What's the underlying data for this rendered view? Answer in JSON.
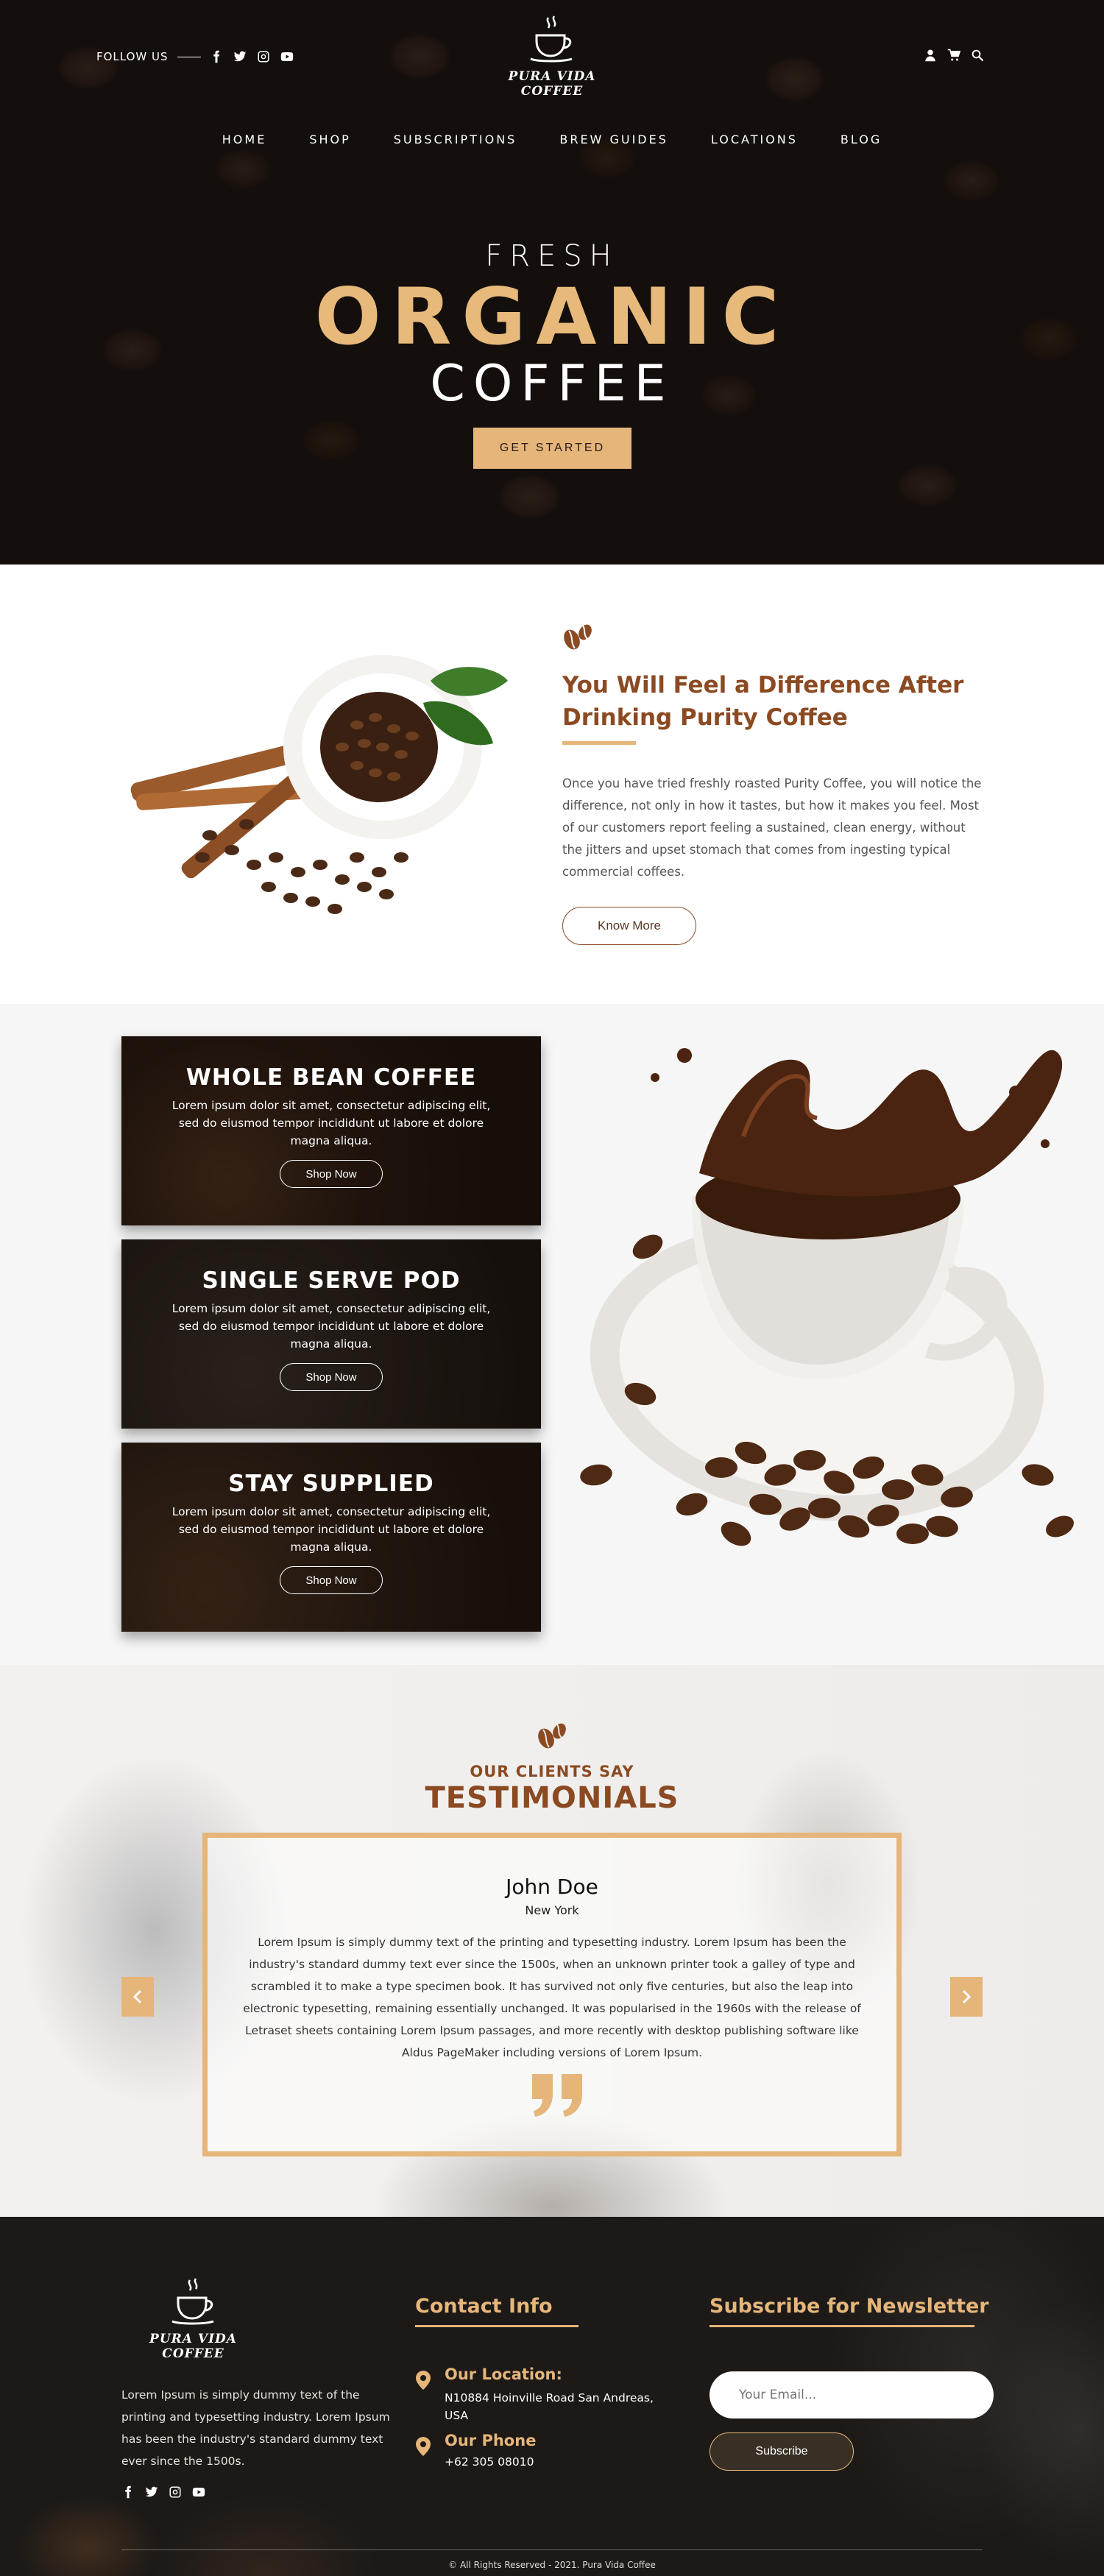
{
  "header": {
    "follow_label": "FOLLOW US",
    "social_icons": [
      "facebook-icon",
      "twitter-icon",
      "instagram-icon",
      "youtube-icon"
    ],
    "logo_text": "PURA VIDA COFFEE",
    "action_icons": [
      "user-icon",
      "cart-icon",
      "search-icon"
    ]
  },
  "nav": {
    "items": [
      "HOME",
      "SHOP",
      "SUBSCRIPTIONS",
      "BREW GUIDES",
      "LOCATIONS",
      "BLOG"
    ]
  },
  "hero": {
    "line1": "FRESH",
    "line2": "ORGANIC",
    "line3": "COFFEE",
    "cta": "GET STARTED"
  },
  "about": {
    "title": "You Will Feel a Difference After Drinking Purity Coffee",
    "text": "Once you have tried freshly roasted Purity Coffee, you will notice the difference, not only in how it tastes, but how it makes you feel. Most of our customers report feeling a sustained, clean energy, without the jitters and upset stomach that comes from ingesting typical commercial coffees.",
    "button": "Know More"
  },
  "products": {
    "cards": [
      {
        "title": "WHOLE BEAN COFFEE",
        "desc": "Lorem ipsum dolor sit amet, consectetur adipiscing elit, sed do eiusmod tempor incididunt ut labore et dolore magna aliqua.",
        "button": "Shop Now"
      },
      {
        "title": "SINGLE SERVE POD",
        "desc": "Lorem ipsum dolor sit amet, consectetur adipiscing elit, sed do eiusmod tempor incididunt ut labore et dolore magna aliqua.",
        "button": "Shop Now"
      },
      {
        "title": "STAY SUPPLIED",
        "desc": "Lorem ipsum dolor sit amet, consectetur adipiscing elit, sed do eiusmod tempor incididunt ut labore et dolore magna aliqua.",
        "button": "Shop Now"
      }
    ]
  },
  "testimonials": {
    "subtitle": "OUR CLIENTS SAY",
    "title": "TESTIMONIALS",
    "name": "John Doe",
    "location": "New York",
    "text": "Lorem Ipsum is simply dummy text of the printing and typesetting industry. Lorem Ipsum has been the industry's standard dummy text ever since the 1500s, when an unknown printer took a galley of type and scrambled it to make a type specimen book. It has survived not only five centuries, but also the leap into electronic typesetting, remaining essentially unchanged. It was popularised in the 1960s with the release of Letraset sheets containing Lorem Ipsum passages, and more recently with desktop publishing software like Aldus PageMaker including versions of Lorem Ipsum."
  },
  "footer": {
    "logo_text": "PURA VIDA COFFEE",
    "about": "Lorem Ipsum is simply dummy text of the printing and typesetting industry. Lorem Ipsum has been the industry's standard dummy text ever since the 1500s.",
    "contact_heading": "Contact Info",
    "location_label": "Our Location:",
    "location_value": "N10884 Hoinville Road San Andreas, USA",
    "phone_label": "Our Phone",
    "phone_value": "+62 305 08010",
    "newsletter_heading": "Subscribe for Newsletter",
    "email_placeholder": "Your Email...",
    "subscribe_button": "Subscribe",
    "copyright": "© All Rights Reserved - 2021. Pura Vida Coffee"
  },
  "colors": {
    "accent_gold": "#e5b57a",
    "brand_brown": "#8b4a22",
    "dark": "#1c1917"
  }
}
